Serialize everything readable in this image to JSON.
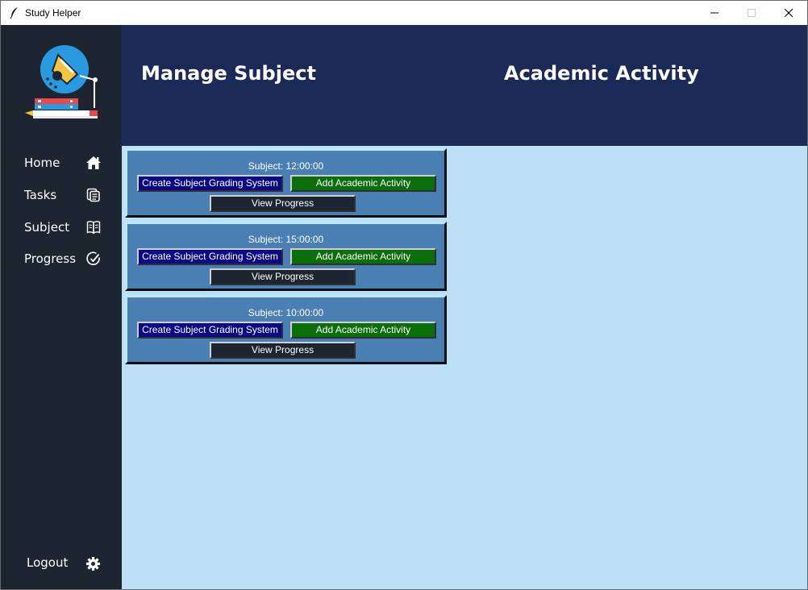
{
  "window": {
    "title": "Study Helper",
    "controls": {
      "minimize": "minimize",
      "maximize": "maximize",
      "close": "close"
    }
  },
  "sidebar": {
    "nav": [
      {
        "label": "Home",
        "icon": "home-icon"
      },
      {
        "label": "Tasks",
        "icon": "tasks-icon"
      },
      {
        "label": "Subject",
        "icon": "book-icon"
      },
      {
        "label": "Progress",
        "icon": "progress-check-icon"
      }
    ],
    "logout": {
      "label": "Logout",
      "icon": "gear-icon"
    }
  },
  "header": {
    "left_title": "Manage Subject",
    "right_title": "Academic Activity"
  },
  "subjects": [
    {
      "title": "Subject: 12:00:00",
      "grading_label": "Create Subject Grading System",
      "add_label": "Add Academic Activity",
      "view_label": "View Progress"
    },
    {
      "title": "Subject: 15:00:00",
      "grading_label": "Create Subject Grading System",
      "add_label": "Add Academic Activity",
      "view_label": "View Progress"
    },
    {
      "title": "Subject: 10:00:00",
      "grading_label": "Create Subject Grading System",
      "add_label": "Add Academic Activity",
      "view_label": "View Progress"
    }
  ],
  "colors": {
    "sidebar": "#1d2630",
    "header": "#1b2a56",
    "content": "#bde0f7",
    "card": "#4a7fb3",
    "grading_button": "#0a0a86",
    "add_button": "#0a6e0a",
    "view_button": "#1c2530"
  }
}
